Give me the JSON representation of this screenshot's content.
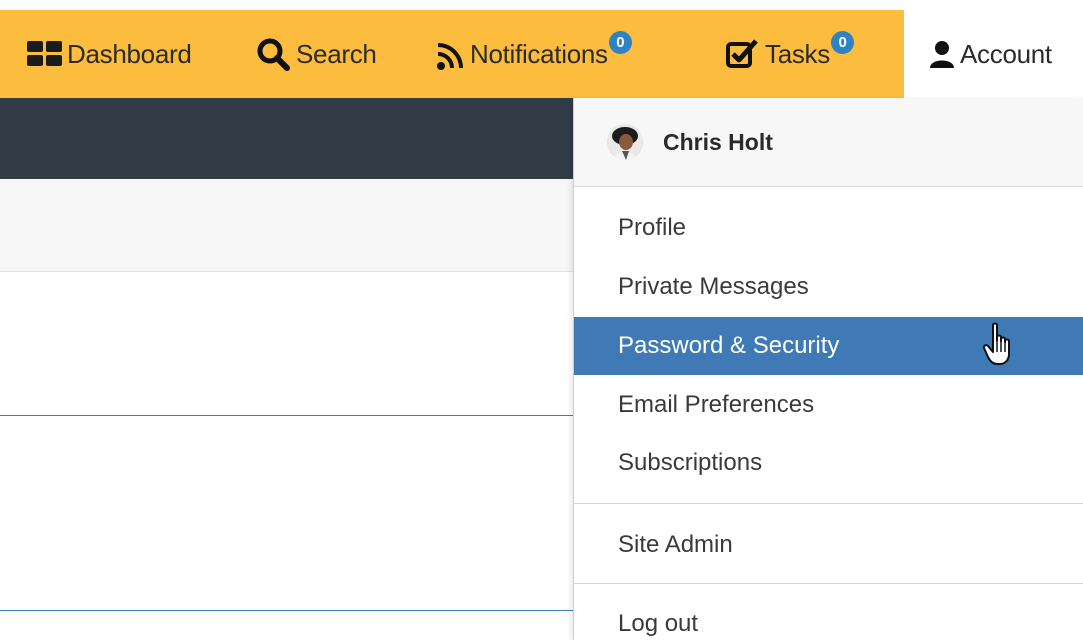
{
  "nav": {
    "items": [
      {
        "label": "Dashboard",
        "icon": "dashboard-icon"
      },
      {
        "label": "Search",
        "icon": "search-icon"
      },
      {
        "label": "Notifications",
        "icon": "rss-icon",
        "badge": "0"
      },
      {
        "label": "Tasks",
        "icon": "checkbox-icon",
        "badge": "0"
      },
      {
        "label": "Account",
        "icon": "user-icon"
      }
    ],
    "bg_color": "#fcbc3d",
    "badge_color": "#2f82c5"
  },
  "account_menu": {
    "user_name": "Chris Holt",
    "items": [
      {
        "label": "Profile"
      },
      {
        "label": "Private Messages"
      },
      {
        "label": "Password & Security",
        "active": true
      },
      {
        "label": "Email Preferences"
      },
      {
        "label": "Subscriptions"
      },
      {
        "label": "Site Admin"
      },
      {
        "label": "Log out"
      }
    ],
    "active_color": "#3f7ab6"
  }
}
